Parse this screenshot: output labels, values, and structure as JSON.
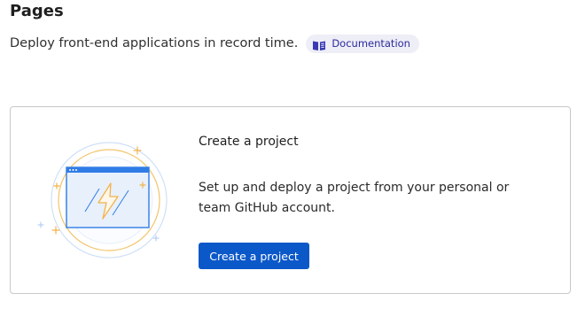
{
  "header": {
    "title": "Pages",
    "subtitle": "Deploy front-end applications in record time.",
    "doc_link": {
      "label": "Documentation",
      "icon": "book-icon"
    }
  },
  "empty_state": {
    "illustration": "browser-window-lightning-icon",
    "title": "Create a project",
    "description": "Set up and deploy a project from your personal or team GitHub account.",
    "button_label": "Create a project"
  },
  "colors": {
    "primary": "#0b58c9",
    "link_bg": "#eeeef7",
    "link_text": "#2b2a9c",
    "illustration_blue": "#2f7ce6",
    "illustration_orange": "#f3b24a",
    "card_border": "#c8c8c8"
  }
}
